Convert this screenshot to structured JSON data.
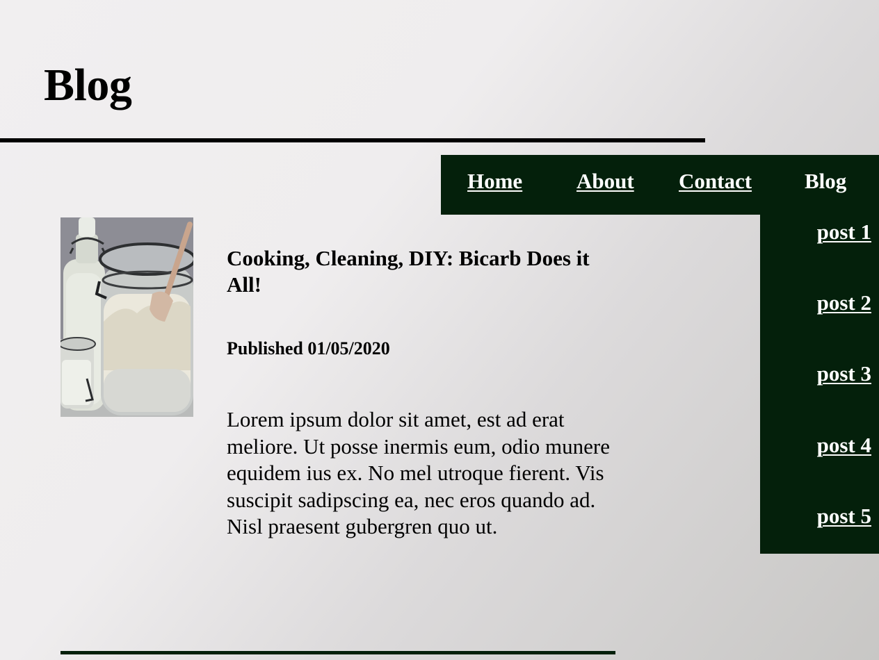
{
  "header": {
    "title": "Blog"
  },
  "nav": {
    "items": [
      {
        "label": "Home"
      },
      {
        "label": "About"
      },
      {
        "label": "Contact"
      },
      {
        "label": "Blog"
      }
    ]
  },
  "sidebar": {
    "posts": [
      {
        "label": "post 1"
      },
      {
        "label": "post 2"
      },
      {
        "label": "post 3"
      },
      {
        "label": "post 4"
      },
      {
        "label": "post 5"
      }
    ]
  },
  "post": {
    "title": "Cooking, Cleaning, DIY: Bicarb Does it All!",
    "published": "Published 01/05/2020",
    "body": "Lorem ipsum dolor sit amet, est ad erat meliore. Ut posse inermis eum, odio munere equidem ius ex. No mel utroque fierent. Vis suscipit sadipscing ea, nec eros quando ad. Nisl praesent gubergren quo ut."
  },
  "colors": {
    "nav_background": "#04200b",
    "nav_text": "#ffffff",
    "rule": "#000000"
  }
}
